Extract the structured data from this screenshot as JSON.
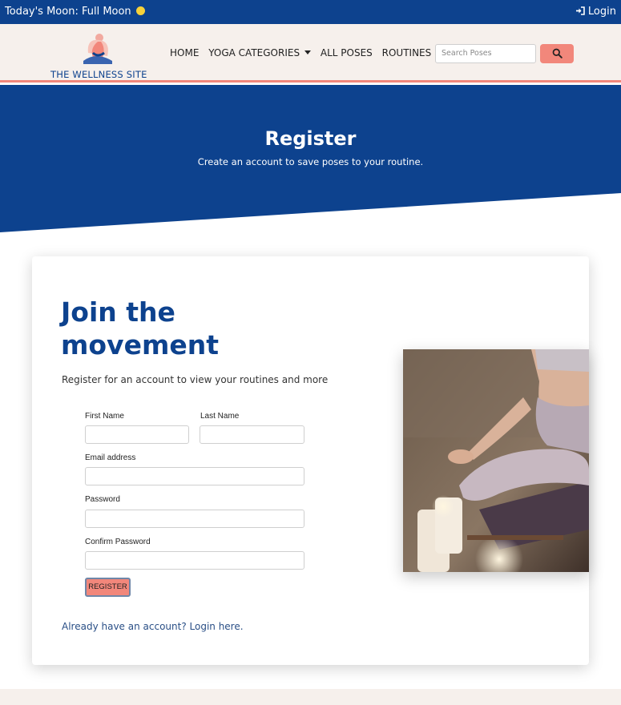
{
  "topbar": {
    "moon_text": "Today's Moon: Full Moon",
    "login_label": "Login"
  },
  "nav": {
    "brand": "THE WELLNESS SITE",
    "links": [
      "HOME",
      "YOGA CATEGORIES",
      "ALL POSES",
      "ROUTINES"
    ],
    "search_placeholder": "Search Poses"
  },
  "hero": {
    "title": "Register",
    "subtitle": "Create an account to save poses to your routine."
  },
  "form": {
    "heading": "Join the movement",
    "intro": "Register for an account to view your routines and more",
    "first_name_label": "First Name",
    "last_name_label": "Last Name",
    "email_label": "Email address",
    "password_label": "Password",
    "confirm_password_label": "Confirm Password",
    "register_label": "REGISTER",
    "login_prompt": "Already have an account? Login here."
  },
  "colors": {
    "primary": "#0d428e",
    "accent": "#f2877b",
    "nav_bg": "#f6f0ec",
    "moon": "#f7d23a"
  },
  "icons": [
    "moon-icon",
    "login-icon",
    "logo-icon",
    "caret-down-icon",
    "search-icon"
  ]
}
